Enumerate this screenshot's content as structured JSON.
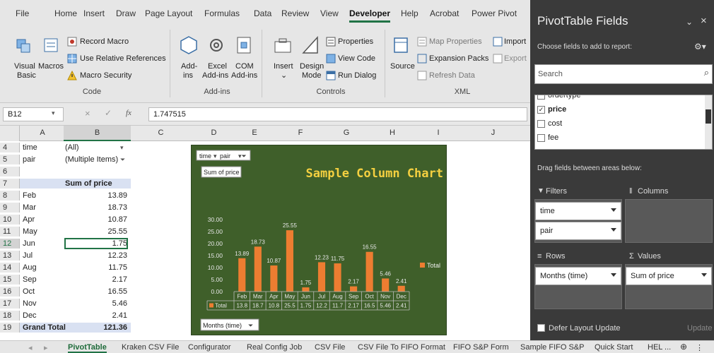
{
  "ribbon": {
    "tabs": [
      "File",
      "Home",
      "Insert",
      "Draw",
      "Page Layout",
      "Formulas",
      "Data",
      "Review",
      "View",
      "Developer",
      "Help",
      "Acrobat",
      "Power Pivot"
    ],
    "active_tab": "Developer",
    "code": {
      "visual_basic": "Visual Basic",
      "visual_1": "Visual",
      "visual_2": "Basic",
      "macros": "Macros",
      "record_macro": "Record Macro",
      "use_relative": "Use Relative References",
      "macro_security": "Macro Security",
      "group": "Code"
    },
    "addins": {
      "addins_1": "Add-",
      "addins_2": "ins",
      "excel_1": "Excel",
      "excel_2": "Add-ins",
      "com_1": "COM",
      "com_2": "Add-ins",
      "group": "Add-ins"
    },
    "controls": {
      "insert": "Insert",
      "design_1": "Design",
      "design_2": "Mode",
      "properties": "Properties",
      "view_code": "View Code",
      "run_dialog": "Run Dialog",
      "group": "Controls"
    },
    "xml": {
      "source": "Source",
      "map_properties": "Map Properties",
      "expansion_packs": "Expansion Packs",
      "refresh_data": "Refresh Data",
      "import": "Import",
      "export": "Export",
      "group": "XML"
    }
  },
  "formula_bar": {
    "name_box": "B12",
    "fx": "fx",
    "value": "1.747515"
  },
  "sheet": {
    "columns": [
      "A",
      "B",
      "C",
      "D",
      "E",
      "F",
      "G",
      "H",
      "I",
      "J"
    ],
    "rows": [
      {
        "n": "4",
        "a": "time",
        "b": "(All)"
      },
      {
        "n": "5",
        "a": "pair",
        "b": "(Multiple Items)"
      },
      {
        "n": "6",
        "a": "",
        "b": ""
      },
      {
        "n": "7",
        "a": "",
        "b": "Sum of price"
      },
      {
        "n": "8",
        "a": "Feb",
        "b": "13.89"
      },
      {
        "n": "9",
        "a": "Mar",
        "b": "18.73"
      },
      {
        "n": "10",
        "a": "Apr",
        "b": "10.87"
      },
      {
        "n": "11",
        "a": "May",
        "b": "25.55"
      },
      {
        "n": "12",
        "a": "Jun",
        "b": "1.75"
      },
      {
        "n": "13",
        "a": "Jul",
        "b": "12.23"
      },
      {
        "n": "14",
        "a": "Aug",
        "b": "11.75"
      },
      {
        "n": "15",
        "a": "Sep",
        "b": "2.17"
      },
      {
        "n": "16",
        "a": "Oct",
        "b": "16.55"
      },
      {
        "n": "17",
        "a": "Nov",
        "b": "5.46"
      },
      {
        "n": "18",
        "a": "Dec",
        "b": "2.41"
      },
      {
        "n": "19",
        "a": "Grand Total",
        "b": "121.36"
      }
    ]
  },
  "chart_data": {
    "type": "bar",
    "title": "Sample Column Chart",
    "categories": [
      "Feb",
      "Mar",
      "Apr",
      "May",
      "Jun",
      "Jul",
      "Aug",
      "Sep",
      "Oct",
      "Nov",
      "Dec"
    ],
    "series": [
      {
        "name": "Total",
        "values": [
          13.89,
          18.73,
          10.87,
          25.55,
          1.75,
          12.23,
          11.75,
          2.17,
          16.55,
          5.46,
          2.41
        ]
      }
    ],
    "data_labels": [
      "13.89",
      "18.73",
      "10.87",
      "25.55",
      "1.75",
      "12.23",
      "11.75",
      "2.17",
      "16.55",
      "5.46",
      "2.41"
    ],
    "table_values": [
      "13.8",
      "18.7",
      "10.8",
      "25.5",
      "1.75",
      "12.2",
      "11.7",
      "2.17",
      "16.5",
      "5.46",
      "2.41"
    ],
    "y_ticks": [
      "0.00",
      "5.00",
      "10.00",
      "15.00",
      "20.00",
      "25.00",
      "30.00"
    ],
    "ylim": [
      0,
      30
    ],
    "legend": "Total",
    "legend_position": "right",
    "filter_buttons": [
      "time",
      "pair"
    ],
    "value_button": "Sum of price",
    "axis_button": "Months (time)",
    "bar_color": "#ed7d31",
    "background_color": "#3f5f2a",
    "title_color": "#f5d040"
  },
  "pivot_pane": {
    "title": "PivotTable Fields",
    "choose": "Choose fields to add to report:",
    "search_placeholder": "Search",
    "fields": [
      {
        "label": "ordertype",
        "checked": false
      },
      {
        "label": "price",
        "checked": true
      },
      {
        "label": "cost",
        "checked": false
      },
      {
        "label": "fee",
        "checked": false
      }
    ],
    "drag_hint": "Drag fields between areas below:",
    "filters_label": "Filters",
    "columns_label": "Columns",
    "rows_label": "Rows",
    "values_label": "Values",
    "filters": [
      "time",
      "pair"
    ],
    "rows": [
      "Months (time)"
    ],
    "values": [
      "Sum of price"
    ],
    "defer": "Defer Layout Update",
    "update": "Update"
  },
  "sheet_tabs": {
    "tabs": [
      "PivotTable",
      "Kraken CSV File",
      "Configurator",
      "Real Config Job",
      "CSV File",
      "CSV File To FIFO Format",
      "FIFO S&P Form",
      "Sample FIFO S&P",
      "Quick Start",
      "HEL ..."
    ],
    "active": "PivotTable"
  }
}
